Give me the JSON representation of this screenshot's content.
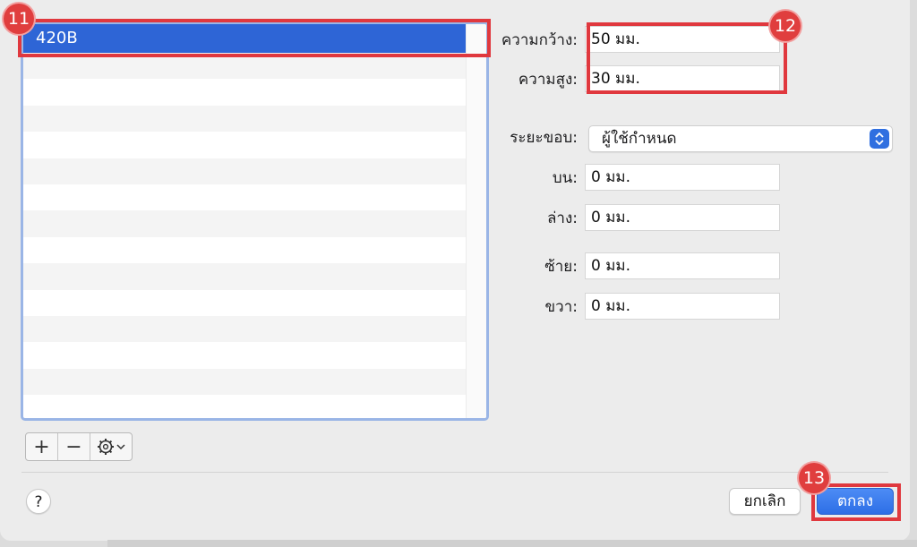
{
  "list": {
    "items": [
      "420B"
    ],
    "selected_index": 0
  },
  "list_tools": {
    "add_label": "+",
    "remove_label": "−"
  },
  "size": {
    "width_label": "ความกว้าง:",
    "width_value": "50 มม.",
    "height_label": "ความสูง:",
    "height_value": "30 มม."
  },
  "margins": {
    "label": "ระยะขอบ:",
    "selected": "ผู้ใช้กำหนด",
    "top_label": "บน:",
    "top_value": "0 มม.",
    "bottom_label": "ล่าง:",
    "bottom_value": "0 มม.",
    "left_label": "ซ้าย:",
    "left_value": "0 มม.",
    "right_label": "ขวา:",
    "right_value": "0 มม."
  },
  "footer": {
    "help_label": "?",
    "cancel_label": "ยกเลิก",
    "ok_label": "ตกลง"
  },
  "annotations": {
    "badge_list": "11",
    "badge_size": "12",
    "badge_ok": "13"
  },
  "colors": {
    "accent": "#2e65d6",
    "highlight": "#e0383e"
  }
}
